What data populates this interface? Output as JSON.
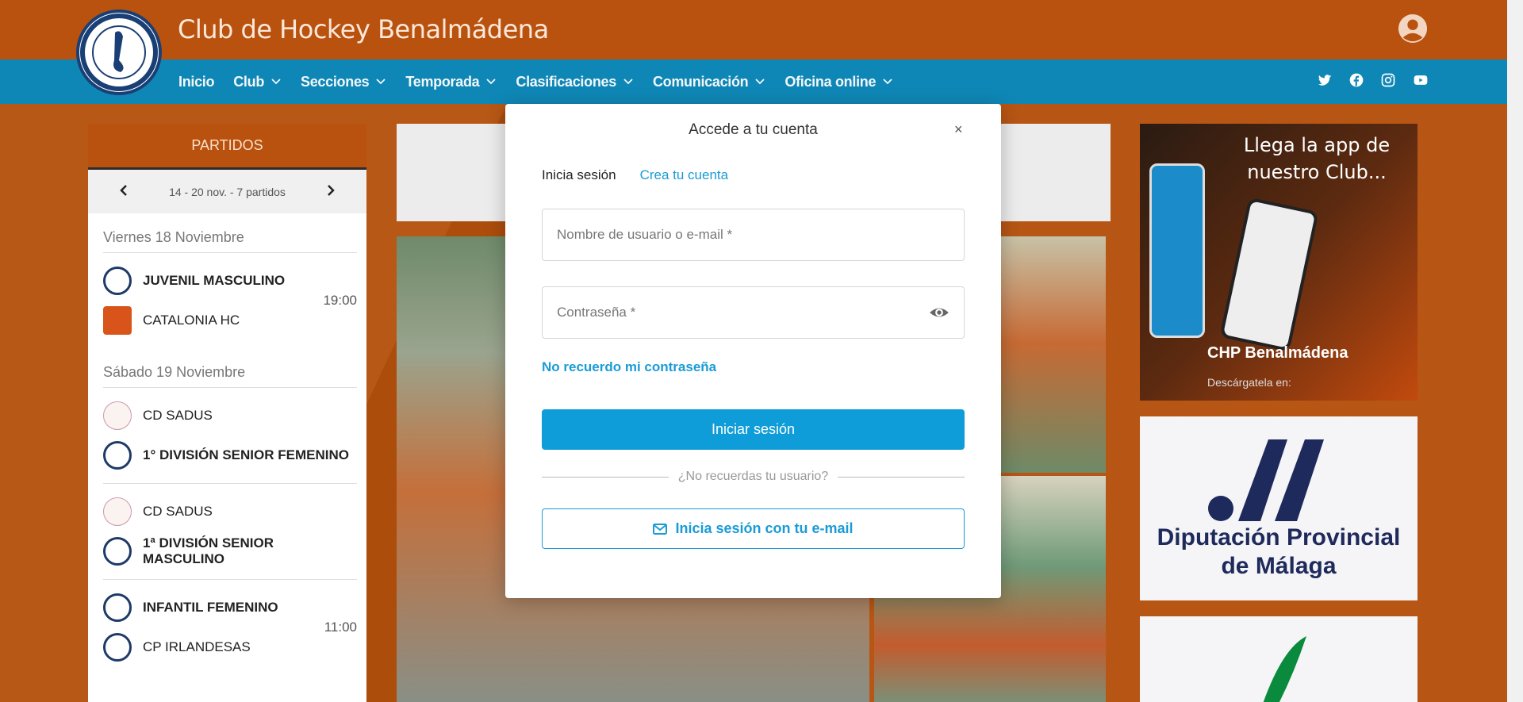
{
  "header": {
    "site_title": "Club de Hockey Benalmádena",
    "nav": [
      {
        "label": "Inicio",
        "dropdown": false
      },
      {
        "label": "Club",
        "dropdown": true
      },
      {
        "label": "Secciones",
        "dropdown": true
      },
      {
        "label": "Temporada",
        "dropdown": true
      },
      {
        "label": "Clasificaciones",
        "dropdown": true
      },
      {
        "label": "Comunicación",
        "dropdown": true
      },
      {
        "label": "Oficina online",
        "dropdown": true
      }
    ],
    "socials": [
      "twitter-icon",
      "facebook-icon",
      "instagram-icon",
      "youtube-icon"
    ]
  },
  "matches": {
    "title": "PARTIDOS",
    "week": "14 - 20 nov. - 7 partidos",
    "days": [
      {
        "label": "Viernes 18 Noviembre",
        "matches": [
          {
            "home": "JUVENIL MASCULINO",
            "away": "CATALONIA HC",
            "time": "19:00"
          }
        ]
      },
      {
        "label": "Sábado 19 Noviembre",
        "matches": [
          {
            "home": "CD SADUS",
            "away": "1° DIVISIÓN SENIOR FEMENINO",
            "time": ""
          },
          {
            "home": "CD SADUS",
            "away": "1ª DIVISIÓN SENIOR MASCULINO",
            "time": ""
          },
          {
            "home": "INFANTIL FEMENINO",
            "away": "CP IRLANDESAS",
            "time": "11:00"
          }
        ]
      }
    ]
  },
  "ads": {
    "app_title": "Llega la app de nuestro Club...",
    "app_name": "CHP Benalmádena",
    "app_download": "Descárgatela en:",
    "diputacion": "Diputación Provincial de Málaga"
  },
  "modal": {
    "title": "Accede a tu cuenta",
    "close": "×",
    "tab_login": "Inicia sesión",
    "tab_register": "Crea tu cuenta",
    "username_placeholder": "Nombre de usuario o e-mail *",
    "password_placeholder": "Contraseña *",
    "forgot_password": "No recuerdo mi contraseña",
    "submit": "Iniciar sesión",
    "divider": "¿No recuerdas tu usuario?",
    "email_login": "Inicia sesión con tu e-mail"
  }
}
